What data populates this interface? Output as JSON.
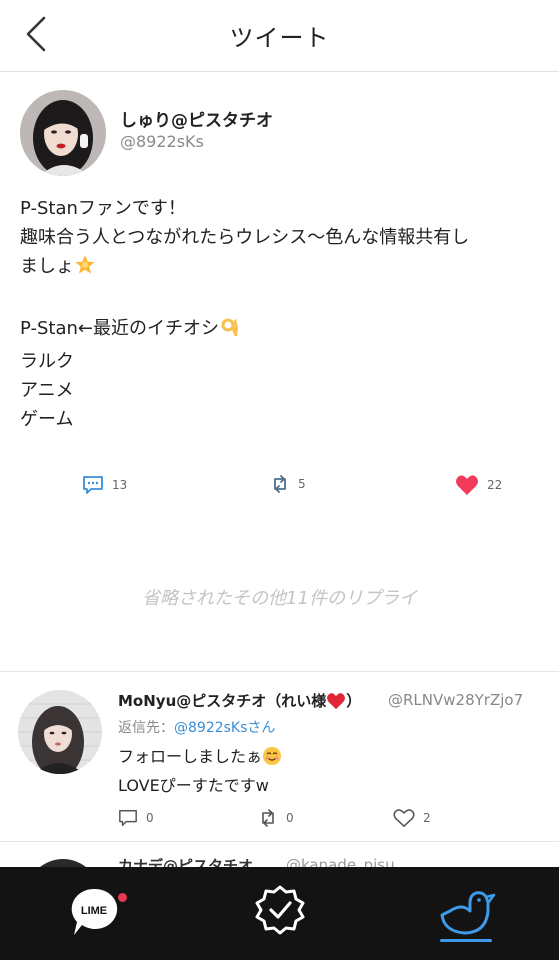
{
  "header": {
    "title": "ツイート"
  },
  "tweet": {
    "author_name": "しゅり@ピスタチオ",
    "author_handle": "@8922sKs",
    "body": {
      "line1": "P-Stanファンです！",
      "line2": "趣味合う人とつながれたらウレシス〜色んな情報共有し",
      "line3": "ましょ",
      "line4": "P-Stan←最近のイチオシ",
      "line5": "ラルク",
      "line6": "アニメ",
      "line7": "ゲーム"
    },
    "emoji": {
      "sparkle": "star-emoji",
      "ok_hand": "ok-hand-emoji"
    },
    "reply_count": "13",
    "retweet_count": "5",
    "like_count": "22",
    "liked": true
  },
  "omitted_replies": "省略されたその他11件のリプライ",
  "reply": {
    "author_name": "MoNyu@ピスタチオ（れい様",
    "author_name_suffix": "）",
    "author_handle": "@RLNVw28YrZjo7",
    "reply_to_label": "返信先：",
    "reply_to_handle": "@8922sKsさん",
    "text_line1": "フォローしましたぁ",
    "text_line2": "LOVEぴーすたですw",
    "reply_count": "0",
    "retweet_count": "0",
    "like_count": "2"
  },
  "next_reply_peek": {
    "author_name": "カナデ@ピスタチオ",
    "author_handle": "@kanade_pisu"
  },
  "tabbar": {
    "lime_label": "LIME",
    "active_tab": "bird"
  },
  "colors": {
    "accent_blue": "#3d9be9",
    "like_red": "#f23a5a",
    "tabbar_bg": "#131313",
    "badge_dot": "#e8384f"
  }
}
